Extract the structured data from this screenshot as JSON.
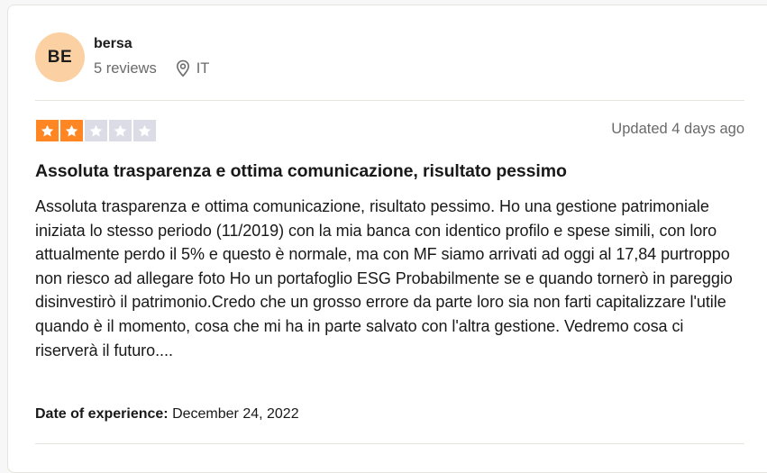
{
  "reviewer": {
    "initials": "BE",
    "name": "bersa",
    "reviews_count": "5 reviews",
    "country": "IT",
    "location_icon": "map-pin-icon"
  },
  "review": {
    "rating": 2,
    "rating_max": 5,
    "updated": "Updated 4 days ago",
    "title": "Assoluta trasparenza e ottima comunicazione, risultato pessimo",
    "text": "Assoluta trasparenza e ottima comunicazione, risultato pessimo. Ho una gestione patrimoniale iniziata lo stesso periodo (11/2019) con la mia banca con identico profilo e spese simili, con loro attualmente perdo il 5% e questo è normale, ma con MF siamo arrivati ad oggi al 17,84 purtroppo non riesco ad allegare foto Ho un portafoglio ESG Probabilmente se e quando tornerò in pareggio disinvestirò il patrimonio.Credo che un grosso errore da parte loro sia non farti capitalizzare l'utile quando è il momento, cosa che mi ha in parte salvato con l'altra gestione. Vedremo cosa ci riserverà il futuro....",
    "experience_label": "Date of experience:",
    "experience_date": "December 24, 2022"
  },
  "colors": {
    "star_filled": "#ff8622",
    "star_empty": "#dcdce6",
    "avatar_bg": "#fbd1a4"
  }
}
